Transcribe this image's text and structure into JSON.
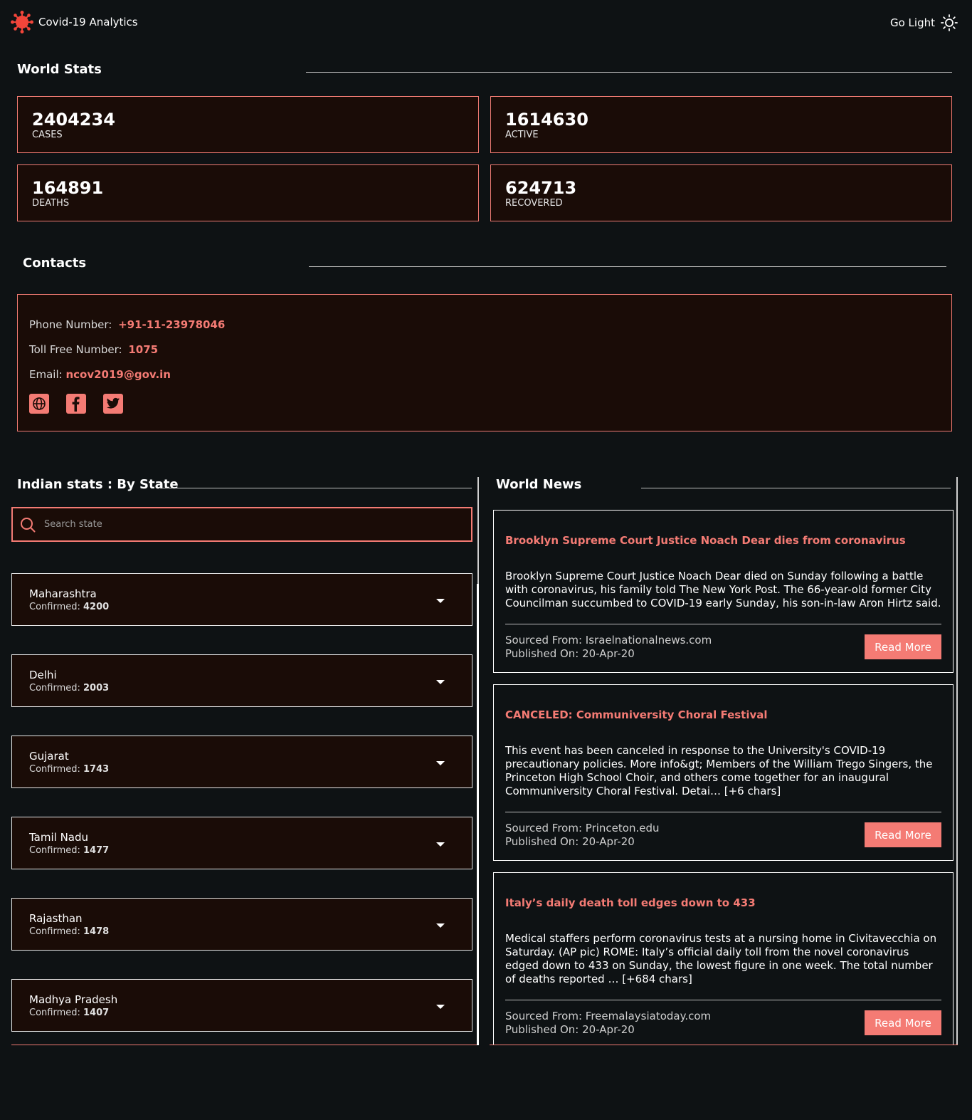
{
  "header": {
    "title": "Covid-19 Analytics",
    "theme_toggle_label": "Go Light"
  },
  "colors": {
    "accent": "#f47b74",
    "background": "#0e1214",
    "card_background": "#1a0c07"
  },
  "world_stats": {
    "heading": "World Stats",
    "cards": [
      {
        "value": "2404234",
        "label": "CASES"
      },
      {
        "value": "1614630",
        "label": "ACTIVE"
      },
      {
        "value": "164891",
        "label": "DEATHS"
      },
      {
        "value": "624713",
        "label": "RECOVERED"
      }
    ]
  },
  "contacts": {
    "heading": "Contacts",
    "phone_label": "Phone Number:",
    "phone_value": "+91-11-23978046",
    "tollfree_label": "Toll Free Number:",
    "tollfree_value": "1075",
    "email_label": "Email:",
    "email_value": "ncov2019@gov.in",
    "social_icons": [
      "globe-icon",
      "facebook-icon",
      "twitter-icon"
    ]
  },
  "india_stats": {
    "heading": "Indian stats : By State",
    "search_placeholder": "Search state",
    "confirmed_label": "Confirmed:",
    "states": [
      {
        "name": "Maharashtra",
        "confirmed": "4200"
      },
      {
        "name": "Delhi",
        "confirmed": "2003"
      },
      {
        "name": "Gujarat",
        "confirmed": "1743"
      },
      {
        "name": "Tamil Nadu",
        "confirmed": "1477"
      },
      {
        "name": "Rajasthan",
        "confirmed": "1478"
      },
      {
        "name": "Madhya Pradesh",
        "confirmed": "1407"
      }
    ]
  },
  "world_news": {
    "heading": "World News",
    "read_more_label": "Read More",
    "items": [
      {
        "title": "Brooklyn Supreme Court Justice Noach Dear dies from coronavirus",
        "body": "Brooklyn Supreme Court Justice Noach Dear died on Sunday following a battle with coronavirus, his family told The New York Post. The 66-year-old former City Councilman succumbed to COVID-19 early Sunday, his son-in-law Aron Hirtz said.",
        "source": "Sourced From: Israelnationalnews.com",
        "published": "Published On: 20-Apr-20"
      },
      {
        "title": "CANCELED: Communiversity Choral Festival",
        "body": "This event has been canceled in response to the University's COVID-19 precautionary policies. More info&gt; Members of the William Trego Singers, the Princeton High School Choir, and others come together for an inaugural Communiversity Choral Festival. Detai… [+6 chars]",
        "source": "Sourced From: Princeton.edu",
        "published": "Published On: 20-Apr-20"
      },
      {
        "title": "Italy’s daily death toll edges down to 433",
        "body": "Medical staffers perform coronavirus tests at a nursing home in Civitavecchia on Saturday. (AP pic) ROME: Italy’s official daily toll from the novel coronavirus edged down to 433 on Sunday, the lowest figure in one week. The total number of deaths reported … [+684 chars]",
        "source": "Sourced From: Freemalaysiatoday.com",
        "published": "Published On: 20-Apr-20"
      }
    ]
  }
}
